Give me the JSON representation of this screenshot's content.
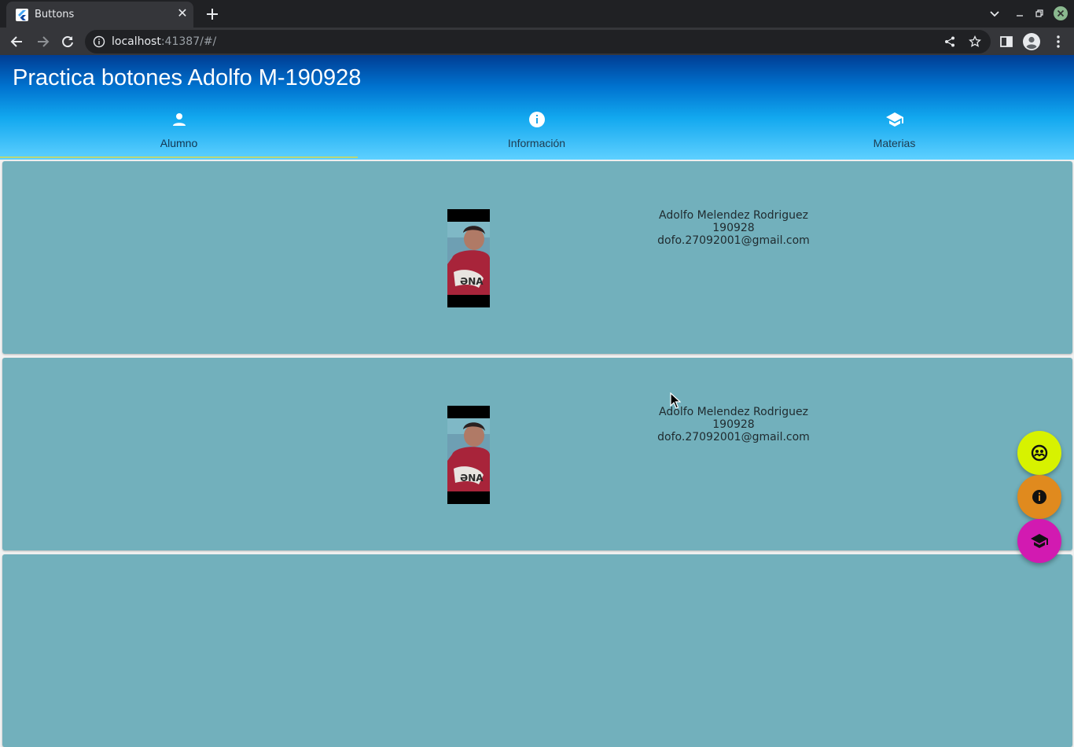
{
  "browser": {
    "tab_title": "Buttons",
    "url_host": "localhost",
    "url_rest": ":41387/#/"
  },
  "app": {
    "title": "Practica botones Adolfo M-190928",
    "tabs": [
      {
        "label": "Alumno",
        "icon": "person-icon"
      },
      {
        "label": "Información",
        "icon": "info-icon"
      },
      {
        "label": "Materias",
        "icon": "school-icon"
      }
    ],
    "active_tab": "Alumno"
  },
  "cards": [
    {
      "name": "Adolfo Melendez Rodriguez",
      "id": "190928",
      "email": "dofo.27092001@gmail.com"
    },
    {
      "name": "Adolfo Melendez Rodriguez",
      "id": "190928",
      "email": "dofo.27092001@gmail.com"
    }
  ],
  "fabs": [
    {
      "icon": "group-icon",
      "color": "#d7f200"
    },
    {
      "icon": "info-icon",
      "color": "#e08a1e"
    },
    {
      "icon": "school-icon",
      "color": "#d21ab1"
    }
  ],
  "colors": {
    "card_bg": "#72b0bc",
    "appbar_top": "#003d93",
    "appbar_bottom": "#5ed0ff",
    "tab_indicator": "#b9d77a"
  }
}
